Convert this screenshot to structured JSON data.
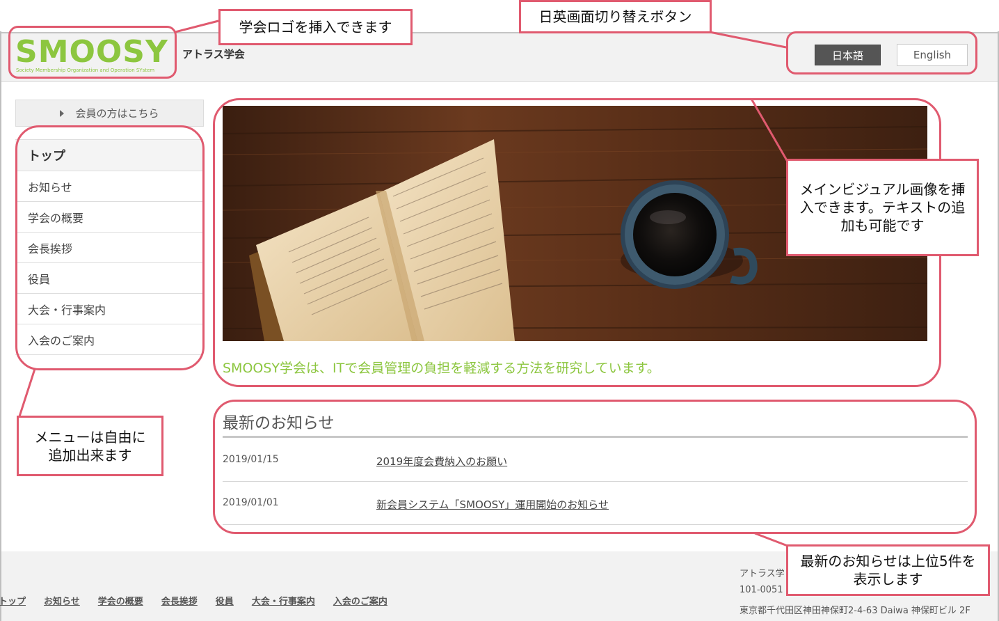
{
  "header": {
    "logo_text": "SMOOSY",
    "logo_subtitle": "Society Membership Organization and Operation SYstem",
    "site_name": "アトラス学会",
    "lang_ja": "日本語",
    "lang_en": "English"
  },
  "sidebar": {
    "member_button": "会員の方はこちら",
    "items": [
      {
        "label": "トップ"
      },
      {
        "label": "お知らせ"
      },
      {
        "label": "学会の概要"
      },
      {
        "label": "会長挨拶"
      },
      {
        "label": "役員"
      },
      {
        "label": "大会・行事案内"
      },
      {
        "label": "入会のご案内"
      }
    ]
  },
  "hero": {
    "tagline": "SMOOSY学会は、ITで会員管理の負担を軽減する方法を研究しています。"
  },
  "news": {
    "title": "最新のお知らせ",
    "items": [
      {
        "date": "2019/01/15",
        "title": "2019年度会費納入のお願い"
      },
      {
        "date": "2019/01/01",
        "title": "新会員システム「SMOOSY」運用開始のお知らせ"
      }
    ]
  },
  "footer": {
    "nav": [
      "トップ",
      "お知らせ",
      "学会の概要",
      "会長挨拶",
      "役員",
      "大会・行事案内",
      "入会のご案内"
    ],
    "org": "アトラス学",
    "postal": "101-0051",
    "address": "東京都千代田区神田神保町2-4-63 Daiwa 神保町ビル 2F"
  },
  "annotations": {
    "logo": "学会ロゴを挿入できます",
    "lang": "日英画面切り替えボタン",
    "visual": "メインビジュアル画像を挿入できます。テキストの追加も可能です",
    "menu": "メニューは自由に追加出来ます",
    "news": "最新のお知らせは上位5件を表示します"
  },
  "colors": {
    "accent_green": "#8cc63f",
    "callout_red": "#e05a6f"
  }
}
